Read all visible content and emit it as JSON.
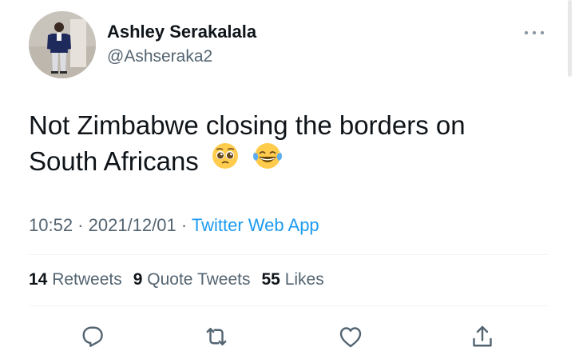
{
  "author": {
    "display_name": "Ashley Serakalala",
    "handle": "@Ashseraka2",
    "avatar_icon": "profile-photo"
  },
  "tweet": {
    "text_line1": "Not Zimbabwe closing the borders on",
    "text_line2": "South Africans",
    "emojis": [
      "pleading-face",
      "face-with-tears-of-joy"
    ]
  },
  "meta": {
    "time": "10:52",
    "separator1": " · ",
    "date": "2021/12/01",
    "separator2": " · ",
    "source": "Twitter Web App"
  },
  "stats": {
    "retweets_count": "14",
    "retweets_label": "Retweets",
    "quotes_count": "9",
    "quotes_label": "Quote Tweets",
    "likes_count": "55",
    "likes_label": "Likes"
  },
  "actions": [
    "reply-icon",
    "retweet-icon",
    "like-icon",
    "share-icon"
  ],
  "colors": {
    "text": "#0f1419",
    "secondary": "#536471",
    "link": "#1d9bf0",
    "divider": "#eff3f4"
  }
}
